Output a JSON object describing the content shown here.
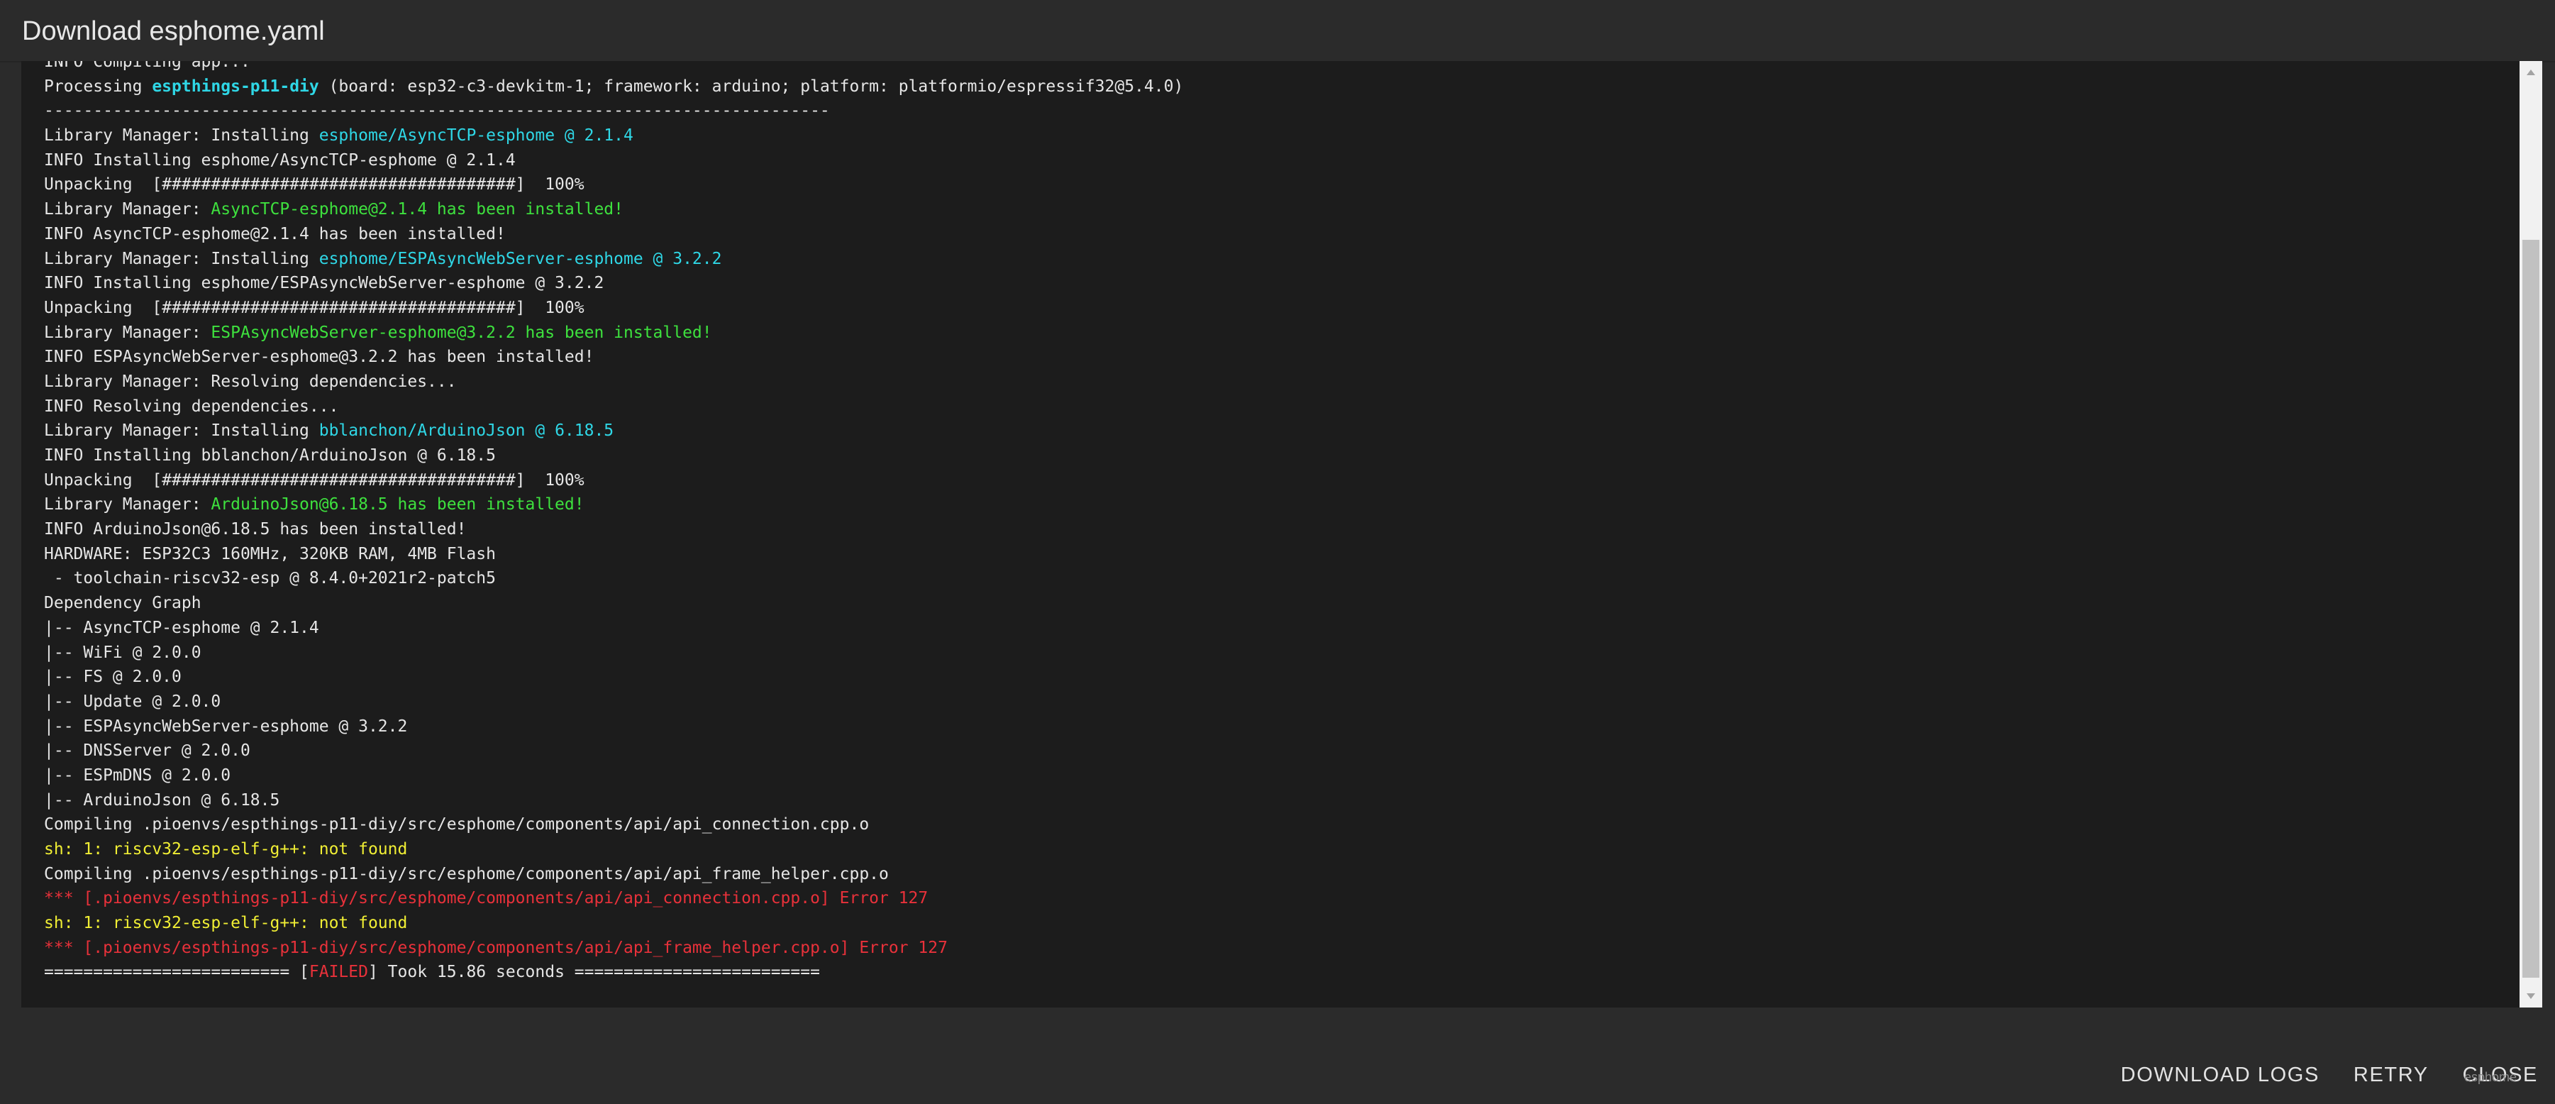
{
  "dialog": {
    "title": "Download esphome.yaml"
  },
  "terminal": {
    "lines": [
      [
        {
          "t": "INFO Compiling app...",
          "c": "default"
        }
      ],
      [
        {
          "t": "Processing ",
          "c": "default"
        },
        {
          "t": "espthings-p11-diy",
          "c": "bold-cyan"
        },
        {
          "t": " (board: esp32-c3-devkitm-1; framework: arduino; platform: platformio/espressif32@5.4.0)",
          "c": "default"
        }
      ],
      [
        {
          "t": "--------------------------------------------------------------------------------",
          "c": "default"
        }
      ],
      [
        {
          "t": "Library Manager: Installing ",
          "c": "default"
        },
        {
          "t": "esphome/AsyncTCP-esphome @ 2.1.4",
          "c": "cyan"
        }
      ],
      [
        {
          "t": "INFO Installing esphome/AsyncTCP-esphome @ 2.1.4",
          "c": "default"
        }
      ],
      [
        {
          "t": "Unpacking  [####################################]  100%",
          "c": "default"
        }
      ],
      [
        {
          "t": "Library Manager: ",
          "c": "default"
        },
        {
          "t": "AsyncTCP-esphome@2.1.4 has been installed!",
          "c": "green"
        }
      ],
      [
        {
          "t": "INFO AsyncTCP-esphome@2.1.4 has been installed!",
          "c": "default"
        }
      ],
      [
        {
          "t": "Library Manager: Installing ",
          "c": "default"
        },
        {
          "t": "esphome/ESPAsyncWebServer-esphome @ 3.2.2",
          "c": "cyan"
        }
      ],
      [
        {
          "t": "INFO Installing esphome/ESPAsyncWebServer-esphome @ 3.2.2",
          "c": "default"
        }
      ],
      [
        {
          "t": "Unpacking  [####################################]  100%",
          "c": "default"
        }
      ],
      [
        {
          "t": "Library Manager: ",
          "c": "default"
        },
        {
          "t": "ESPAsyncWebServer-esphome@3.2.2 has been installed!",
          "c": "green"
        }
      ],
      [
        {
          "t": "INFO ESPAsyncWebServer-esphome@3.2.2 has been installed!",
          "c": "default"
        }
      ],
      [
        {
          "t": "Library Manager: Resolving dependencies...",
          "c": "default"
        }
      ],
      [
        {
          "t": "INFO Resolving dependencies...",
          "c": "default"
        }
      ],
      [
        {
          "t": "Library Manager: Installing ",
          "c": "default"
        },
        {
          "t": "bblanchon/ArduinoJson @ 6.18.5",
          "c": "cyan"
        }
      ],
      [
        {
          "t": "INFO Installing bblanchon/ArduinoJson @ 6.18.5",
          "c": "default"
        }
      ],
      [
        {
          "t": "Unpacking  [####################################]  100%",
          "c": "default"
        }
      ],
      [
        {
          "t": "Library Manager: ",
          "c": "default"
        },
        {
          "t": "ArduinoJson@6.18.5 has been installed!",
          "c": "green"
        }
      ],
      [
        {
          "t": "INFO ArduinoJson@6.18.5 has been installed!",
          "c": "default"
        }
      ],
      [
        {
          "t": "HARDWARE: ESP32C3 160MHz, 320KB RAM, 4MB Flash",
          "c": "default"
        }
      ],
      [
        {
          "t": " - toolchain-riscv32-esp @ 8.4.0+2021r2-patch5",
          "c": "default"
        }
      ],
      [
        {
          "t": "Dependency Graph",
          "c": "default"
        }
      ],
      [
        {
          "t": "|-- AsyncTCP-esphome @ 2.1.4",
          "c": "default"
        }
      ],
      [
        {
          "t": "|-- WiFi @ 2.0.0",
          "c": "default"
        }
      ],
      [
        {
          "t": "|-- FS @ 2.0.0",
          "c": "default"
        }
      ],
      [
        {
          "t": "|-- Update @ 2.0.0",
          "c": "default"
        }
      ],
      [
        {
          "t": "|-- ESPAsyncWebServer-esphome @ 3.2.2",
          "c": "default"
        }
      ],
      [
        {
          "t": "|-- DNSServer @ 2.0.0",
          "c": "default"
        }
      ],
      [
        {
          "t": "|-- ESPmDNS @ 2.0.0",
          "c": "default"
        }
      ],
      [
        {
          "t": "|-- ArduinoJson @ 6.18.5",
          "c": "default"
        }
      ],
      [
        {
          "t": "Compiling .pioenvs/espthings-p11-diy/src/esphome/components/api/api_connection.cpp.o",
          "c": "default"
        }
      ],
      [
        {
          "t": "sh: 1: riscv32-esp-elf-g++: not found",
          "c": "yellow"
        }
      ],
      [
        {
          "t": "Compiling .pioenvs/espthings-p11-diy/src/esphome/components/api/api_frame_helper.cpp.o",
          "c": "default"
        }
      ],
      [
        {
          "t": "*** [.pioenvs/espthings-p11-diy/src/esphome/components/api/api_connection.cpp.o] Error 127",
          "c": "red"
        }
      ],
      [
        {
          "t": "sh: 1: riscv32-esp-elf-g++: not found",
          "c": "yellow"
        }
      ],
      [
        {
          "t": "*** [.pioenvs/espthings-p11-diy/src/esphome/components/api/api_frame_helper.cpp.o] Error 127",
          "c": "red"
        }
      ],
      [
        {
          "t": "========================= [",
          "c": "default"
        },
        {
          "t": "FAILED",
          "c": "red"
        },
        {
          "t": "] Took 15.86 seconds =========================",
          "c": "default"
        }
      ]
    ]
  },
  "actions": {
    "download_logs_label": "Download Logs",
    "retry_label": "Retry",
    "close_label": "Close"
  },
  "footer": {
    "version": "esphome"
  },
  "colors": {
    "background": "#2b2b2b",
    "terminal_bg": "#1c1c1c",
    "cyan": "#2fd7e6",
    "green": "#3ee13e",
    "yellow": "#f0ee34",
    "red": "#e8313a"
  }
}
